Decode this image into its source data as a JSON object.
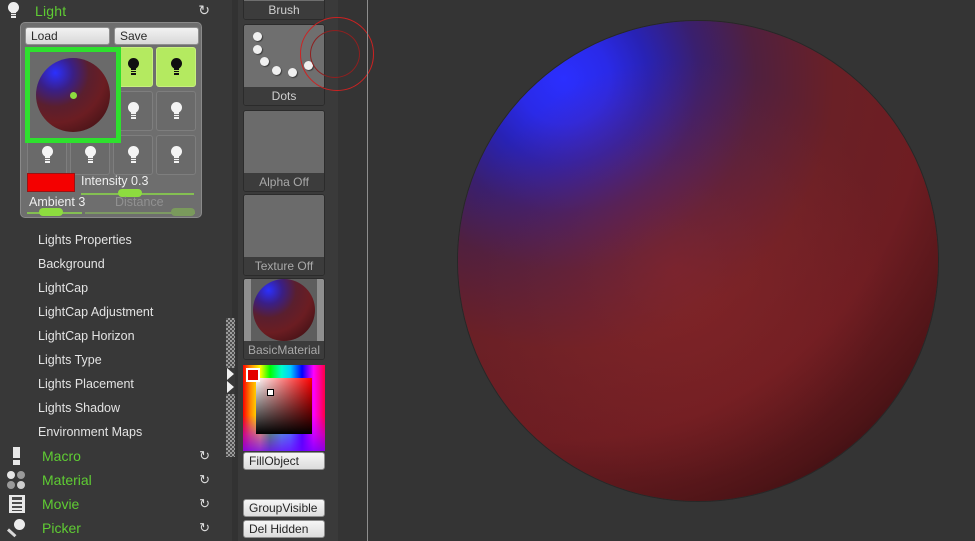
{
  "palette": {
    "title": "Light",
    "icon": "bulb-icon",
    "refresh_icon": "refresh-icon"
  },
  "light_panel": {
    "load_label": "Load",
    "save_label": "Save",
    "preview_name": "light-preview-sphere",
    "slots": [
      {
        "name": "light-slot-2",
        "on": true
      },
      {
        "name": "light-slot-3",
        "on": true
      },
      {
        "name": "light-slot-4",
        "on": false
      },
      {
        "name": "light-slot-5",
        "on": false
      },
      {
        "name": "light-slot-6",
        "on": false
      },
      {
        "name": "light-slot-7",
        "on": false
      },
      {
        "name": "light-slot-8",
        "on": false
      },
      {
        "name": "light-slot-9",
        "on": false
      }
    ],
    "color_swatch": "#f40000",
    "intensity_label": "Intensity 0.3",
    "intensity_value": 0.3,
    "ambient_label": "Ambient 3",
    "ambient_value": 3,
    "distance_label": "Distance",
    "distance_enabled": false
  },
  "menu": {
    "items": [
      "Lights Properties",
      "Background",
      "LightCap",
      "LightCap Adjustment",
      "LightCap Horizon",
      "Lights Type",
      "Lights Placement",
      "Lights Shadow",
      "Environment Maps"
    ]
  },
  "palette_rows": [
    {
      "label": "Macro",
      "icon": "exclamation-icon",
      "refresh": "refresh-icon"
    },
    {
      "label": "Material",
      "icon": "four-circles-icon",
      "refresh": "refresh-icon"
    },
    {
      "label": "Movie",
      "icon": "film-strip-icon",
      "refresh": "refresh-icon"
    },
    {
      "label": "Picker",
      "icon": "magnifier-icon",
      "refresh": "refresh-icon"
    }
  ],
  "toolcol": {
    "thumbs": [
      {
        "caption": "Brush",
        "name": "brush-thumbnail"
      },
      {
        "caption": "Dots",
        "name": "stroke-dots-thumbnail"
      },
      {
        "caption": "Alpha Off",
        "name": "alpha-thumbnail"
      },
      {
        "caption": "Texture Off",
        "name": "texture-thumbnail"
      },
      {
        "caption": "BasicMaterial",
        "name": "material-thumbnail"
      }
    ],
    "buttons": [
      {
        "label": "FillObject",
        "name": "fill-object-button"
      },
      {
        "label": "GroupVisible",
        "name": "group-visible-button"
      },
      {
        "label": "Del Hidden",
        "name": "del-hidden-button"
      }
    ],
    "current_color": "#e40000"
  },
  "canvas": {
    "object_name": "sculpt-sphere",
    "brush_cursor": "brush-size-cursor"
  }
}
